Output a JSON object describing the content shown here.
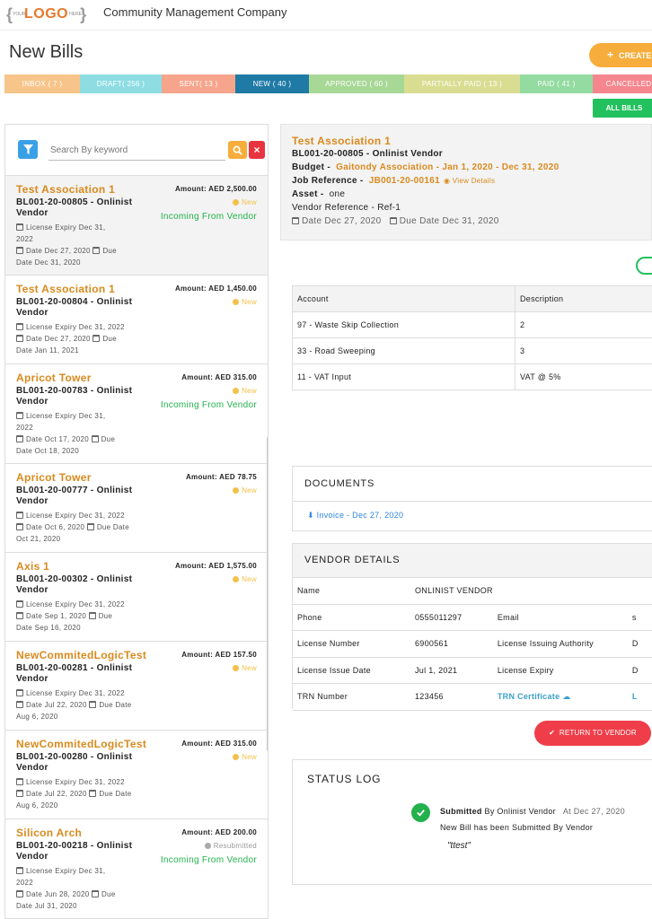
{
  "header": {
    "logo_your": "YOUR",
    "logo_main": "LOGO",
    "logo_here": "HERE",
    "company": "Community Management Company"
  },
  "page": {
    "title": "New Bills",
    "create_label": "CREATE"
  },
  "tabs": [
    {
      "label": "INBOX ( 7 )",
      "color": "#f7c48a"
    },
    {
      "label": "DRAFT( 256 )",
      "color": "#8ddde3"
    },
    {
      "label": "SENT( 13 )",
      "color": "#f6a58c"
    },
    {
      "label": "NEW ( 40 )",
      "color": "#1f7aa5"
    },
    {
      "label": "APPROVED ( 60 )",
      "color": "#a7d896"
    },
    {
      "label": "PARTIALLY PAID ( 13 )",
      "color": "#d9dd92"
    },
    {
      "label": "PAID ( 41 )",
      "color": "#93dba0"
    },
    {
      "label": "CANCELLED",
      "color": "#f5868e"
    }
  ],
  "all_bills_label": "ALL BILLS",
  "search": {
    "placeholder": "Search By keyword",
    "value": "Search By keyword"
  },
  "bills": [
    {
      "name": "Test Association 1",
      "amount": "Amount: AED 2,500.00",
      "number": "BL001-20-00805 - Onlinist Vendor",
      "status": "New",
      "incoming": "Incoming From Vendor",
      "license": "License Expiry Dec 31, 2022",
      "date": "Date Dec 27, 2020",
      "due": "Due Date Dec 31, 2020"
    },
    {
      "name": "Test Association 1",
      "amount": "Amount: AED 1,450.00",
      "number": "BL001-20-00804 - Onlinist Vendor",
      "status": "New",
      "incoming": "",
      "license": "License Expiry Dec 31, 2022",
      "date": "Date Dec 27, 2020",
      "due": "Due Date Jan 11, 2021"
    },
    {
      "name": "Apricot Tower",
      "amount": "Amount: AED 315.00",
      "number": "BL001-20-00783 - Onlinist Vendor",
      "status": "New",
      "incoming": "Incoming From Vendor",
      "license": "License Expiry Dec 31, 2022",
      "date": "Date Oct 17, 2020",
      "due": "Due Date Oct 18, 2020"
    },
    {
      "name": "Apricot Tower",
      "amount": "Amount: AED 78.75",
      "number": "BL001-20-00777 - Onlinist Vendor",
      "status": "New",
      "incoming": "",
      "license": "License Expiry Dec 31, 2022",
      "date": "Date Oct 6, 2020",
      "due": "Due Date Oct 21, 2020"
    },
    {
      "name": "Axis 1",
      "amount": "Amount: AED 1,575.00",
      "number": "BL001-20-00302 - Onlinist Vendor",
      "status": "New",
      "incoming": "",
      "license": "License Expiry Dec 31, 2022",
      "date": "Date Sep 1, 2020",
      "due": "Due Date Sep 16, 2020"
    },
    {
      "name": "NewCommitedLogicTest",
      "amount": "Amount: AED 157.50",
      "number": "BL001-20-00281 - Onlinist Vendor",
      "status": "New",
      "incoming": "",
      "license": "License Expiry Dec 31, 2022",
      "date": "Date Jul 22, 2020",
      "due": "Due Date Aug 6, 2020"
    },
    {
      "name": "NewCommitedLogicTest",
      "amount": "Amount: AED 315.00",
      "number": "BL001-20-00280 - Onlinist Vendor",
      "status": "New",
      "incoming": "",
      "license": "License Expiry Dec 31, 2022",
      "date": "Date Jul 22, 2020",
      "due": "Due Date Aug 6, 2020"
    },
    {
      "name": "Silicon Arch",
      "amount": "Amount: AED 200.00",
      "number": "BL001-20-00218 - Onlinist Vendor",
      "status": "Resubmitted",
      "incoming": "Incoming From Vendor",
      "license": "License Expiry Dec 31, 2022",
      "date": "Date Jun 28, 2020",
      "due": "Due Date Jul 31, 2020"
    }
  ],
  "detail": {
    "title": "Test Association 1",
    "bill_line": "BL001-20-00805 - Onlinist Vendor",
    "budget_label": "Budget -",
    "budget_value": "Gaitondy Association - Jan 1, 2020 - Dec 31, 2020",
    "job_label": "Job Reference -",
    "job_value": "JB001-20-00161",
    "view_details": "View Details",
    "asset_label": "Asset -",
    "asset_value": "one",
    "vendor_ref": "Vendor Reference - Ref-1",
    "date": "Date Dec 27, 2020",
    "due_date": "Due Date Dec 31, 2020"
  },
  "accounts": {
    "headers": [
      "Account",
      "Description"
    ],
    "rows": [
      [
        "97 - Waste Skip Collection",
        "2"
      ],
      [
        "33 - Road Sweeping",
        "3"
      ],
      [
        "11 - VAT Input",
        "VAT @ 5%"
      ]
    ]
  },
  "documents": {
    "title": "DOCUMENTS",
    "link": "Invoice - Dec 27, 2020"
  },
  "vendor": {
    "title": "VENDOR DETAILS",
    "name_label": "Name",
    "name_value": "ONLINIST VENDOR",
    "phone_label": "Phone",
    "phone_value": "0555011297",
    "email_label": "Email",
    "email_value": "s",
    "lic_num_label": "License Number",
    "lic_num_value": "6900561",
    "lic_auth_label": "License Issuing Authority",
    "lic_auth_value": "D",
    "lic_issue_label": "License Issue Date",
    "lic_issue_value": "Jul 1, 2021",
    "lic_exp_label": "License Expiry",
    "lic_exp_value": "D",
    "trn_label": "TRN Number",
    "trn_value": "123456",
    "trn_cert": "TRN Certificate",
    "trn_extra": "L"
  },
  "return_label": "RETURN TO VENDOR",
  "status_log": {
    "title": "STATUS LOG",
    "submitted": "Submitted",
    "by": "By Onlinist Vendor",
    "at": "At Dec 27, 2020",
    "message": "New Bill has been Submitted By Vendor",
    "comment": "\"ttest\""
  },
  "colors": {
    "accent_orange": "#f7ad3b",
    "name_orange": "#d98a1e",
    "green": "#22c15e",
    "red": "#ef3e4a",
    "blue": "#2e86de"
  }
}
